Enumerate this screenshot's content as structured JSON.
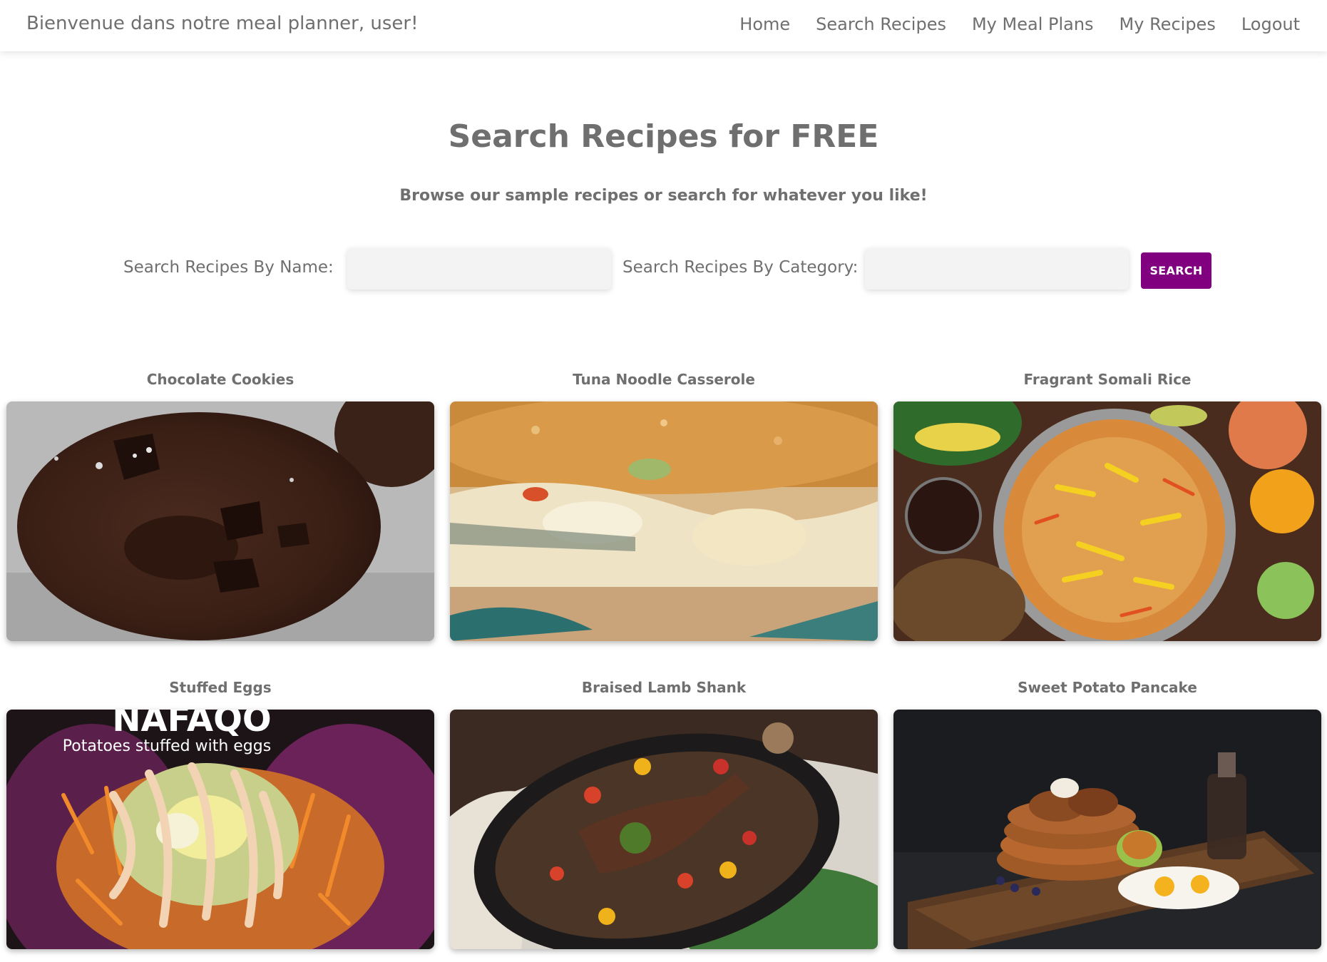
{
  "navbar": {
    "brand": "Bienvenue dans notre meal planner, user!",
    "links": [
      "Home",
      "Search Recipes",
      "My Meal Plans",
      "My Recipes",
      "Logout"
    ]
  },
  "hero": {
    "title": "Search Recipes for FREE",
    "subtitle": "Browse our sample recipes or search for whatever you like!"
  },
  "search": {
    "name_label": "Search Recipes By Name:",
    "category_label": "Search Recipes By Category:",
    "name_value": "",
    "category_value": "",
    "button_label": "SEARCH",
    "button_color": "#800080"
  },
  "recipes": [
    {
      "title": "Chocolate Cookies",
      "image": "chocolate-cookie-photo"
    },
    {
      "title": "Tuna Noodle Casserole",
      "image": "casserole-photo"
    },
    {
      "title": "Fragrant Somali Rice",
      "image": "somali-rice-photo"
    },
    {
      "title": "Stuffed Eggs",
      "image": "stuffed-eggs-photo",
      "image_text": [
        "NAFAQO",
        "Potatoes stuffed with eggs"
      ]
    },
    {
      "title": "Braised Lamb Shank",
      "image": "lamb-shank-photo"
    },
    {
      "title": "Sweet Potato Pancake",
      "image": "pancake-photo"
    }
  ]
}
